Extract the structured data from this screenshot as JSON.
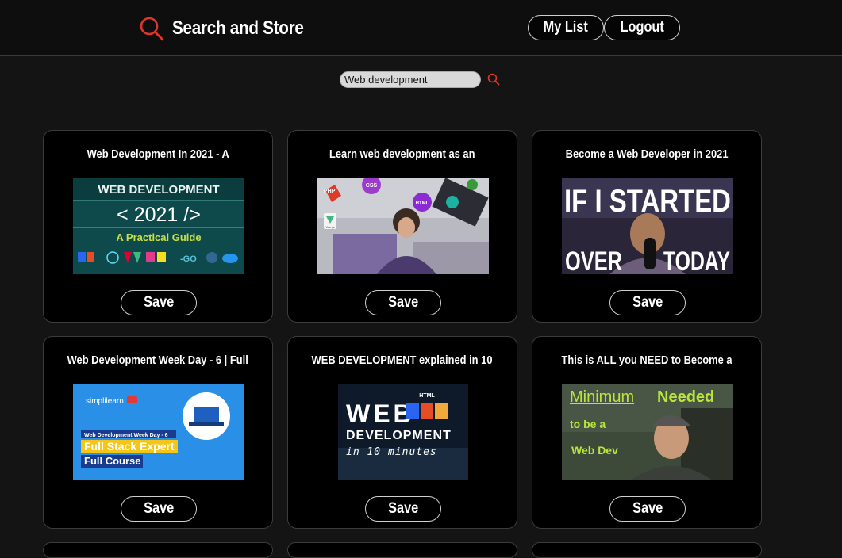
{
  "header": {
    "title": "Search and Store",
    "brand_icon": "search-icon",
    "accent_color": "#e0352b",
    "my_list_label": "My List",
    "logout_label": "Logout"
  },
  "search": {
    "value": "Web development",
    "placeholder": "",
    "button_icon": "search-icon"
  },
  "results": [
    {
      "title": "Web Development In 2021 - A",
      "save_label": "Save",
      "thumbnail": {
        "line1": "WEB DEVELOPMENT",
        "line2": "< 2021 />",
        "line3": "A Practical Guide"
      }
    },
    {
      "title": "Learn web development as an",
      "save_label": "Save",
      "thumbnail": {
        "badges": [
          "PHP",
          "CSS",
          "HTML",
          "Vue.js"
        ]
      }
    },
    {
      "title": "Become a Web Developer in 2021",
      "save_label": "Save",
      "thumbnail": {
        "line1": "IF I STARTED",
        "line2a": "OVER",
        "line2b": "TODAY"
      }
    },
    {
      "title": "Web Development Week Day - 6 | Full",
      "save_label": "Save",
      "thumbnail": {
        "brand": "simplilearn",
        "tag": "Web Development Week Day - 6",
        "line1": "Full Stack Expert",
        "line2": "Full Course"
      }
    },
    {
      "title": "WEB DEVELOPMENT explained in 10",
      "save_label": "Save",
      "thumbnail": {
        "line1": "WEB",
        "line2": "DEVELOPMENT",
        "line3": "in 10 minutes",
        "badge": "HTML"
      }
    },
    {
      "title": "This is ALL you NEED to Become a",
      "save_label": "Save",
      "thumbnail": {
        "line1a": "Minimum",
        "line1b": "Needed",
        "line2": "to be a",
        "line3": "Web Dev"
      }
    }
  ]
}
